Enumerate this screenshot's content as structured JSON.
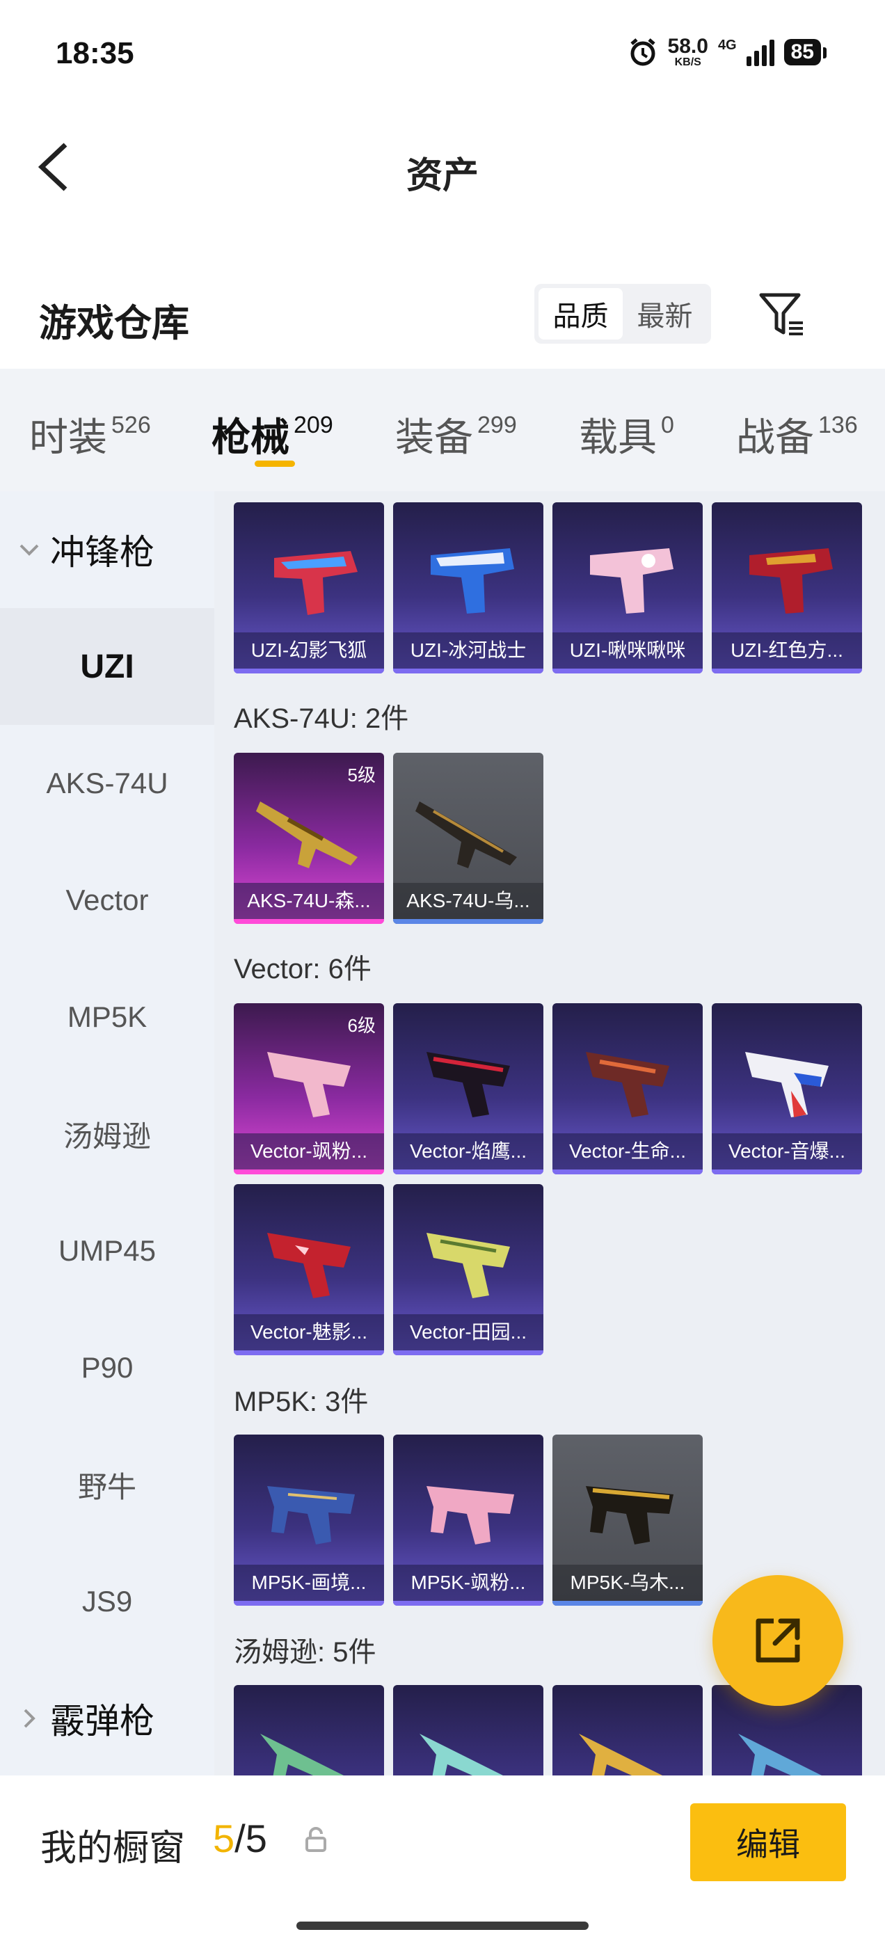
{
  "status": {
    "time": "18:35",
    "speed_value": "58.0",
    "speed_unit": "KB/S",
    "network": "4G",
    "battery": "85"
  },
  "header": {
    "title": "资产"
  },
  "section": {
    "title": "游戏仓库",
    "sort_options": [
      "品质",
      "最新"
    ],
    "active_sort": "品质"
  },
  "tabs": [
    {
      "label": "时装",
      "count": "526"
    },
    {
      "label": "枪械",
      "count": "209"
    },
    {
      "label": "装备",
      "count": "299"
    },
    {
      "label": "载具",
      "count": "0"
    },
    {
      "label": "战备",
      "count": "136"
    }
  ],
  "sidebar": {
    "groups": [
      "冲锋枪",
      "霰弹枪"
    ],
    "items": [
      "UZI",
      "AKS-74U",
      "Vector",
      "MP5K",
      "汤姆逊",
      "UMP45",
      "P90",
      "野牛",
      "JS9"
    ]
  },
  "content": {
    "uzi_cards": [
      "UZI-幻影飞狐",
      "UZI-冰河战士",
      "UZI-啾咪啾咪",
      "UZI-红色方..."
    ],
    "aks_label": "AKS-74U: 2件",
    "aks_cards": [
      "AKS-74U-森...",
      "AKS-74U-乌..."
    ],
    "aks_level": "5级",
    "vector_label": "Vector: 6件",
    "vector_cards": [
      "Vector-飒粉...",
      "Vector-焰鹰...",
      "Vector-生命...",
      "Vector-音爆...",
      "Vector-魅影...",
      "Vector-田园..."
    ],
    "vector_level": "6级",
    "mp5k_label": "MP5K: 3件",
    "mp5k_cards": [
      "MP5K-画境...",
      "MP5K-飒粉...",
      "MP5K-乌木..."
    ],
    "thompson_label": "汤姆逊: 5件"
  },
  "bottom": {
    "title": "我的橱窗",
    "current": "5",
    "separator": "/",
    "total": "5",
    "edit_label": "编辑"
  },
  "colors": {
    "accent": "#f8b91b",
    "purple_card": "#3c3280",
    "pink_card": "#e24ad8",
    "gray_card": "#4a4c52"
  }
}
